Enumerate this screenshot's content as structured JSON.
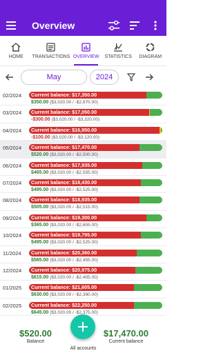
{
  "app": {
    "title": "Overview"
  },
  "tabs": [
    {
      "label": "HOME",
      "icon": "home-icon"
    },
    {
      "label": "TRANSACTIONS",
      "icon": "list-icon"
    },
    {
      "label": "OVERVIEW",
      "icon": "bar-chart-icon",
      "active": true
    },
    {
      "label": "STATISTICS",
      "icon": "statistics-icon"
    },
    {
      "label": "DIAGRAM",
      "icon": "pie-chart-icon"
    }
  ],
  "period": {
    "month": "May",
    "year": "2024"
  },
  "rows": [
    {
      "date": "02/2024",
      "balance_label": "Current balance: $17,350.00",
      "net": "$350.00",
      "detail": "($3,020.00 / -$2,670.00)",
      "net_negative": false,
      "spent_fraction": 0.88
    },
    {
      "date": "03/2024",
      "balance_label": "Current balance: $17,050.00",
      "net": "-$300.00",
      "detail": "($3,020.00 / -$3,320.00)",
      "net_negative": true,
      "spent_fraction": 0.9,
      "overspent_mark": true
    },
    {
      "date": "04/2024",
      "balance_label": "Current balance: $16,950.00",
      "net": "-$100.00",
      "detail": "($3,020.00 / -$3,120.00)",
      "net_negative": true,
      "spent_fraction": 0.98,
      "overspent_mark": true
    },
    {
      "date": "05/2024",
      "balance_label": "Current balance: $17,470.00",
      "net": "$520.00",
      "detail": "($3,020.00 / -$2,500.00)",
      "net_negative": false,
      "spent_fraction": 0.83,
      "current": true
    },
    {
      "date": "06/2024",
      "balance_label": "Current balance: $17,935.00",
      "net": "$465.00",
      "detail": "($3,020.00 / -$2,555.00)",
      "net_negative": false,
      "spent_fraction": 0.85
    },
    {
      "date": "07/2024",
      "balance_label": "Current balance: $18,430.00",
      "net": "$495.00",
      "detail": "($3,020.00 / -$2,525.00)",
      "net_negative": false,
      "spent_fraction": 0.84
    },
    {
      "date": "08/2024",
      "balance_label": "Current balance: $18,935.00",
      "net": "$505.00",
      "detail": "($3,020.00 / -$2,515.00)",
      "net_negative": false,
      "spent_fraction": 0.83
    },
    {
      "date": "09/2024",
      "balance_label": "Current balance: $19,300.00",
      "net": "$365.00",
      "detail": "($3,020.00 / -$2,655.00)",
      "net_negative": false,
      "spent_fraction": 0.88
    },
    {
      "date": "10/2024",
      "balance_label": "Current balance: $19,795.00",
      "net": "$495.00",
      "detail": "($3,020.00 / -$2,525.00)",
      "net_negative": false,
      "spent_fraction": 0.84
    },
    {
      "date": "11/2024",
      "balance_label": "Current balance: $20,360.00",
      "net": "$565.00",
      "detail": "($3,020.00 / -$2,455.00)",
      "net_negative": false,
      "spent_fraction": 0.81
    },
    {
      "date": "12/2024",
      "balance_label": "Current balance: $20,975.00",
      "net": "$615.00",
      "detail": "($3,020.00 / -$2,405.00)",
      "net_negative": false,
      "spent_fraction": 0.8
    },
    {
      "date": "01/2025",
      "balance_label": "Current balance: $21,605.00",
      "net": "$630.00",
      "detail": "($3,020.00 / -$2,390.00)",
      "net_negative": false,
      "spent_fraction": 0.79
    },
    {
      "date": "02/2025",
      "balance_label": "Current balance: $22,250.00",
      "net": "$645.00",
      "detail": "($3,020.00 / -$2,375.00)",
      "net_negative": false,
      "spent_fraction": 0.79
    }
  ],
  "footer": {
    "left_amount": "$520.00",
    "left_label": "Balance",
    "right_amount": "$17,470.00",
    "right_label": "Current balance",
    "center_label": "All accounts"
  },
  "colors": {
    "primary": "#6a1fd6",
    "spent": "#d32f2f",
    "remaining": "#4caf50",
    "positive": "#2e7d32",
    "negative": "#c62828",
    "fab": "#14c7a8"
  }
}
